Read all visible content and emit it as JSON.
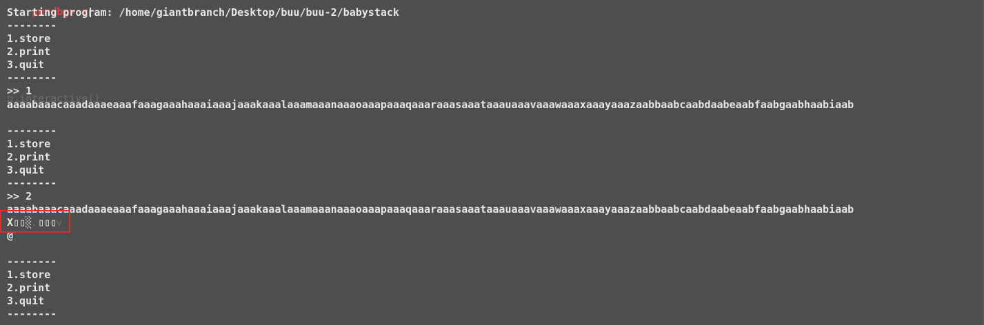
{
  "terminal": {
    "prompt_partial": "pwndbg> r",
    "lines": [
      "Starting program: /home/giantbranch/Desktop/buu/buu-2/babystack",
      "--------",
      "1.store",
      "2.print",
      "3.quit",
      "--------",
      ">> 1",
      "aaaabaaacaaadaaaeaaafaaagaaahaaaiaaajaaakaaalaaamaaanaaaoaaapaaaqaaaraaasaaataaauaaavaaawaaaxaaayaaazaabbaabcaabdaabeaabfaabgaabhaabiaab",
      "",
      "--------",
      "1.store",
      "2.print",
      "3.quit",
      "--------",
      ">> 2",
      "aaaabaaacaaadaaaeaaafaaagaaahaaaiaaajaaakaaalaaamaaanaaaoaaapaaaqaaaraaasaaataaauaaavaaawaaaxaaayaaazaabbaabcaabdaabeaabfaabgaabhaabiaab",
      "X\u0000\u0000 \u0000\u0000\u0000",
      "@",
      "",
      "--------",
      "1.store",
      "2.print",
      "3.quit",
      "--------"
    ],
    "ghost_text_1": "p.interactive()",
    "ghost_text_2": "p.recv",
    "leak_display": "X▯▯░ ▯▯▯",
    "highlight_color": "#e02b2b",
    "prompt_color": "#d64545"
  }
}
